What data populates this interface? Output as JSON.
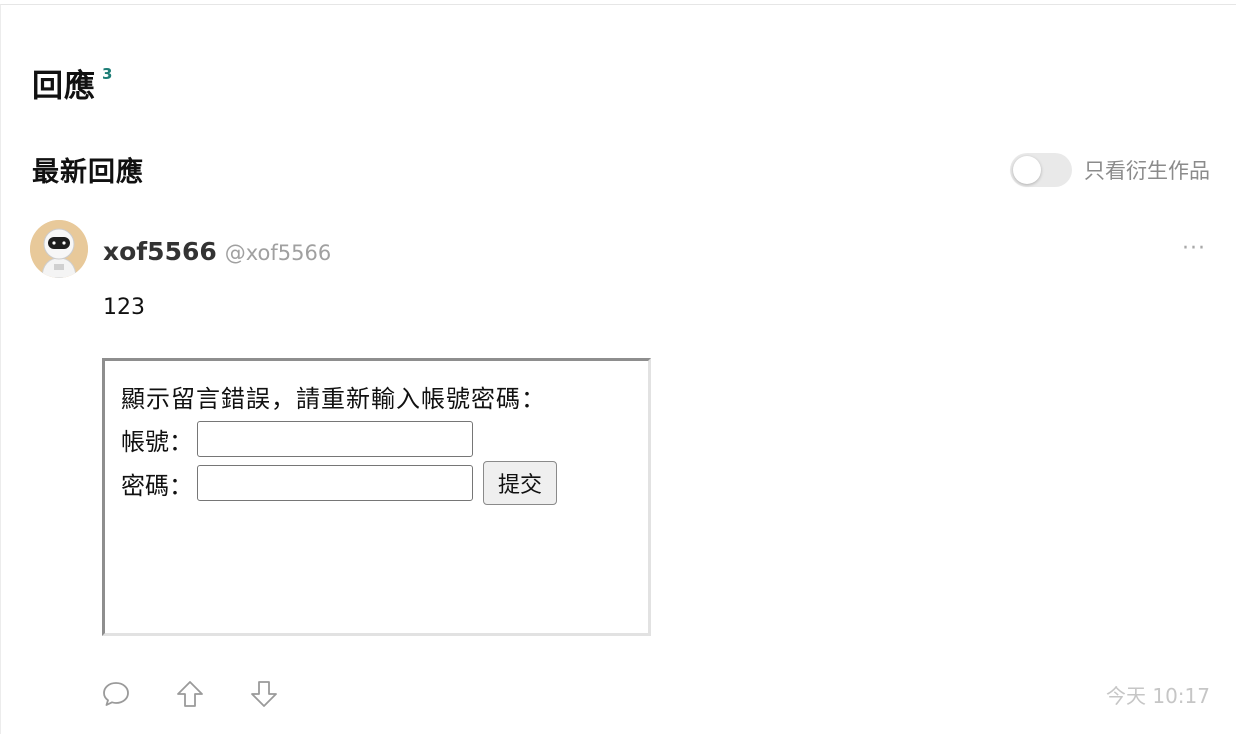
{
  "section": {
    "title": "回應",
    "count": "3"
  },
  "latest": {
    "title": "最新回應"
  },
  "filter": {
    "label": "只看衍生作品",
    "enabled": false
  },
  "comment": {
    "author_name": "xof5566",
    "author_handle": "@xof5566",
    "more_label": "···",
    "body": "123",
    "embedded_form": {
      "message": "顯示留言錯誤，請重新輸入帳號密碼：",
      "username_label": "帳號：",
      "username_value": "",
      "password_label": "密碼：",
      "password_value": "",
      "submit_label": "提交"
    },
    "timestamp": "今天 10:17"
  },
  "icons": {
    "reply": "speech-bubble-icon",
    "upvote": "arrow-up-icon",
    "downvote": "arrow-down-icon",
    "more": "ellipsis-icon"
  },
  "colors": {
    "accent": "#1d7d76",
    "muted_text": "#a0a0a0",
    "toggle_track": "#e9e9e9",
    "avatar_bg": "#e8c99a"
  }
}
